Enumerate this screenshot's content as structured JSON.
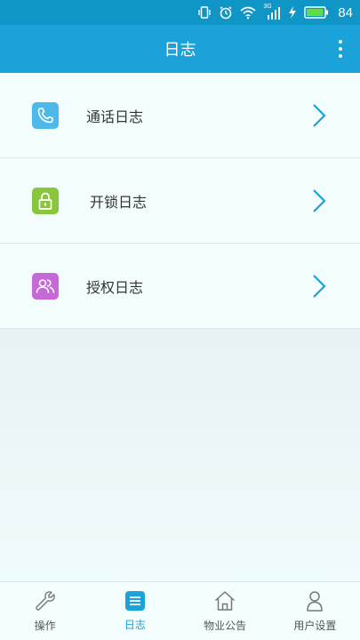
{
  "status_bar": {
    "battery_percent": "84",
    "network_label": "3G"
  },
  "header": {
    "title": "日志",
    "menu_icon": "more-vertical-icon"
  },
  "log_list": [
    {
      "label": "通话日志",
      "icon": "phone-icon",
      "icon_color": "#4db8ea"
    },
    {
      "label": "开锁日志",
      "icon": "lock-icon",
      "icon_color": "#8ac63c"
    },
    {
      "label": "授权日志",
      "icon": "users-icon",
      "icon_color": "#c668d8"
    }
  ],
  "chevron_color": "#1ba2d9",
  "bottom_nav": {
    "items": [
      {
        "label": "操作",
        "icon": "wrench-icon",
        "active": false
      },
      {
        "label": "日志",
        "icon": "list-icon",
        "active": true
      },
      {
        "label": "物业公告",
        "icon": "home-icon",
        "active": false
      },
      {
        "label": "用户设置",
        "icon": "user-icon",
        "active": false
      }
    ]
  },
  "colors": {
    "primary": "#1ba2d9",
    "status_bar": "#0f95c6",
    "background": "#eef7f8"
  }
}
